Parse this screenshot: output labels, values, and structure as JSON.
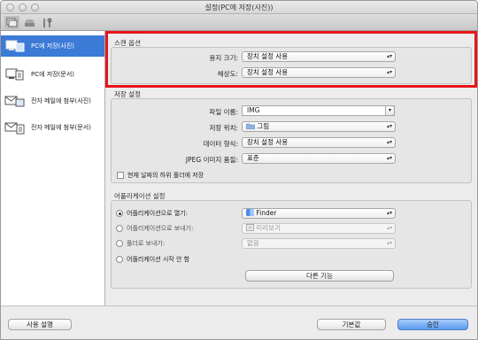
{
  "window": {
    "title": "설정(PC에 저장(사진))"
  },
  "sidebar": {
    "items": [
      {
        "label": "PC에 저장(사진)",
        "icon": "pc-save-photo-icon"
      },
      {
        "label": "PC에 저장(문서)",
        "icon": "pc-save-document-icon"
      },
      {
        "label": "전자 메일에 첨부(사진)",
        "icon": "email-attach-icon"
      },
      {
        "label": "전자 메일에 첨부(문서)",
        "icon": "email-attach-icon"
      }
    ]
  },
  "scan_options": {
    "title": "스캔 옵션",
    "paper_size": {
      "label": "용지 크기:",
      "value": "장치 설정 사용"
    },
    "resolution": {
      "label": "해상도:",
      "value": "장치 설정 사용"
    }
  },
  "save_settings": {
    "title": "저장 설정",
    "file_name": {
      "label": "파일 이름:",
      "value": "IMG"
    },
    "save_in": {
      "label": "저장 위치:",
      "value": "그림"
    },
    "data_format": {
      "label": "데이터 형식:",
      "value": "장치 설정 사용"
    },
    "jpeg_quality": {
      "label": "JPEG 이미지 품질:",
      "value": "표준"
    },
    "subfolder_checkbox": {
      "label": "현재 날짜의 하위 폴더에 저장",
      "checked": false
    }
  },
  "app_settings": {
    "title": "어플리케이션 설정",
    "open_with": {
      "label": "어플리케이션으로 열기:",
      "value": "Finder",
      "selected": true
    },
    "send_to_app": {
      "label": "어플리케이션으로 보내기:",
      "value": "미리보기",
      "selected": false
    },
    "send_to_folder": {
      "label": "폴더로 보내기:",
      "value": "없음",
      "selected": false
    },
    "do_not_start": {
      "label": "어플리케이션 시작 안 함",
      "selected": false
    },
    "more_functions": "다른 기능"
  },
  "footer": {
    "instructions": "사용 설명",
    "defaults": "기본값",
    "ok": "승인"
  },
  "colors": {
    "selection": "#3b7ad6",
    "highlight_box": "#e8141b",
    "default_button": "#5a9af0"
  }
}
